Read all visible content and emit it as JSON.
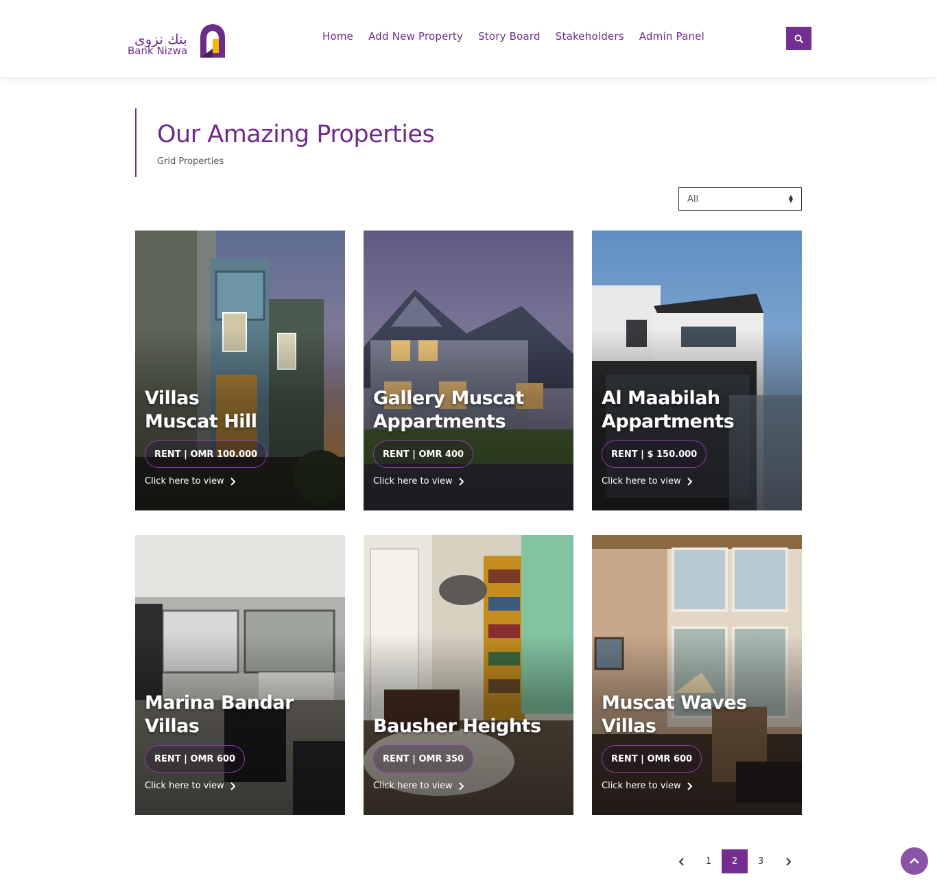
{
  "brand": {
    "name_arabic": "بنك نزوى",
    "name_latin": "Bank Nizwa"
  },
  "nav": {
    "items": [
      {
        "label": "Home"
      },
      {
        "label": "Add New Property"
      },
      {
        "label": "Story Board"
      },
      {
        "label": "Stakeholders"
      },
      {
        "label": "Admin Panel"
      }
    ],
    "search_icon": "search-icon"
  },
  "section": {
    "title": "Our Amazing Properties",
    "subtitle": "Grid Properties"
  },
  "filter": {
    "selected": "All"
  },
  "properties": [
    {
      "title_line1": "Villas",
      "title_line2": "Muscat Hill",
      "price": "RENT | OMR 100.000",
      "cta": "Click here to view"
    },
    {
      "title_line1": "Gallery Muscat",
      "title_line2": "Appartments",
      "price": "RENT | OMR 400",
      "cta": "Click here to view"
    },
    {
      "title_line1": "Al Maabilah",
      "title_line2": "Appartments",
      "price": "RENT | $ 150.000",
      "cta": "Click here to view"
    },
    {
      "title_line1": "Marina Bandar",
      "title_line2": "Villas",
      "price": "RENT | OMR 600",
      "cta": "Click here to view"
    },
    {
      "title_line1": "",
      "title_line2": "Bausher Heights",
      "price": "RENT | OMR 350",
      "cta": "Click here to view"
    },
    {
      "title_line1": "Muscat Waves",
      "title_line2": "Villas",
      "price": "RENT | OMR 600",
      "cta": "Click here to view"
    }
  ],
  "pagination": {
    "pages": [
      "1",
      "2",
      "3"
    ],
    "current": "2"
  },
  "colors": {
    "brand_purple": "#742d91",
    "nav_text": "#6f2b8b",
    "scroll_top": "#8b54a6"
  }
}
